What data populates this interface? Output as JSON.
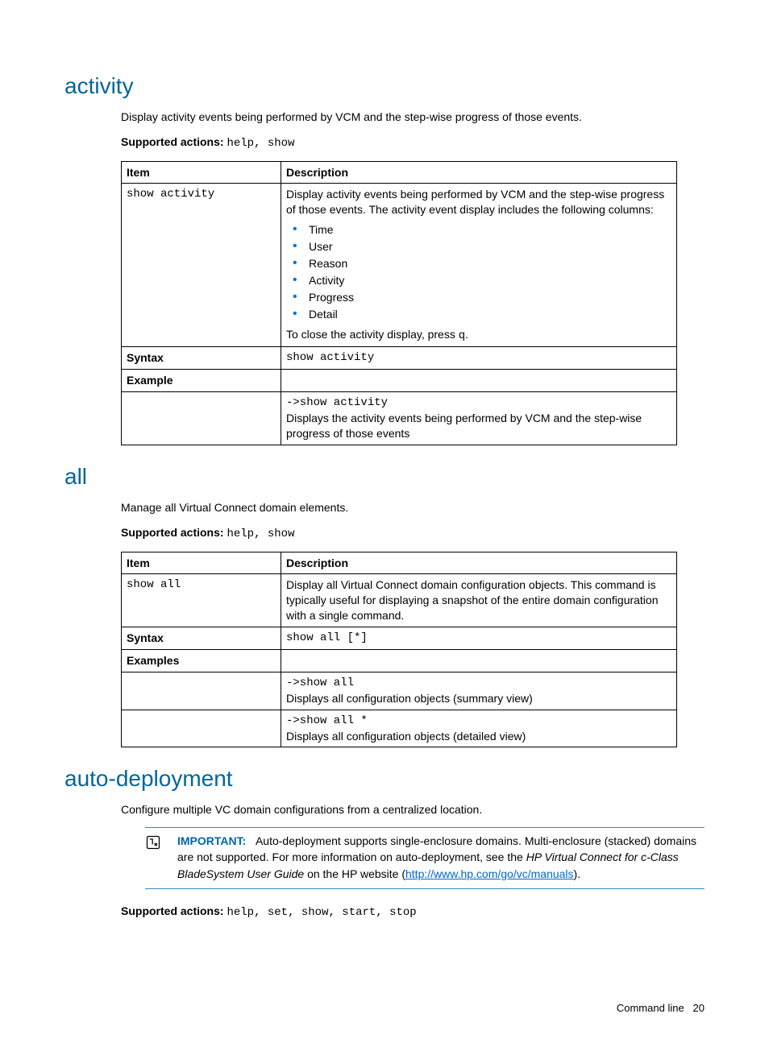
{
  "sections": {
    "activity": {
      "heading": "activity",
      "intro": "Display activity events being performed by VCM and the step-wise progress of those events.",
      "supported_actions_label": "Supported actions",
      "supported_actions": "help, show",
      "table": {
        "head_item": "Item",
        "head_desc": "Description",
        "row_item": "show activity",
        "row_desc_intro": "Display activity events being performed by VCM and the step-wise progress of those events. The activity event display includes the following columns:",
        "cols": [
          "Time",
          "User",
          "Reason",
          "Activity",
          "Progress",
          "Detail"
        ],
        "close_pre": "To close the activity display, press ",
        "close_key": "q",
        "close_post": ".",
        "syntax_label": "Syntax",
        "syntax_val": "show activity",
        "example_label": "Example",
        "ex_cmd": "->show activity",
        "ex_desc": "Displays the activity events being performed by VCM and the step-wise progress of those events"
      }
    },
    "all": {
      "heading": "all",
      "intro": "Manage all Virtual Connect domain elements.",
      "supported_actions_label": "Supported actions",
      "supported_actions": "help, show",
      "table": {
        "head_item": "Item",
        "head_desc": "Description",
        "row_item": "show all",
        "row_desc": "Display all Virtual Connect domain configuration objects. This command is typically useful for displaying a snapshot of the entire domain configuration with a single command.",
        "syntax_label": "Syntax",
        "syntax_val": "show all [*]",
        "examples_label": "Examples",
        "ex1_cmd": "->show all",
        "ex1_desc": "Displays all configuration objects (summary view)",
        "ex2_cmd": "->show all *",
        "ex2_desc": "Displays all configuration objects (detailed view)"
      }
    },
    "auto": {
      "heading": "auto-deployment",
      "intro": "Configure multiple VC domain configurations from a centralized location.",
      "important_label": "IMPORTANT:",
      "important_pre": "Auto-deployment supports single-enclosure domains. Multi-enclosure (stacked) domains are not supported. For more information on auto-deployment, see the ",
      "important_doc": "HP Virtual Connect for c-Class BladeSystem User Guide",
      "important_mid": " on the HP website (",
      "important_link": "http://www.hp.com/go/vc/manuals",
      "important_post": ").",
      "supported_actions_label": "Supported actions",
      "supported_actions": "help, set, show, start, stop"
    }
  },
  "footer": {
    "section": "Command line",
    "page": "20"
  }
}
